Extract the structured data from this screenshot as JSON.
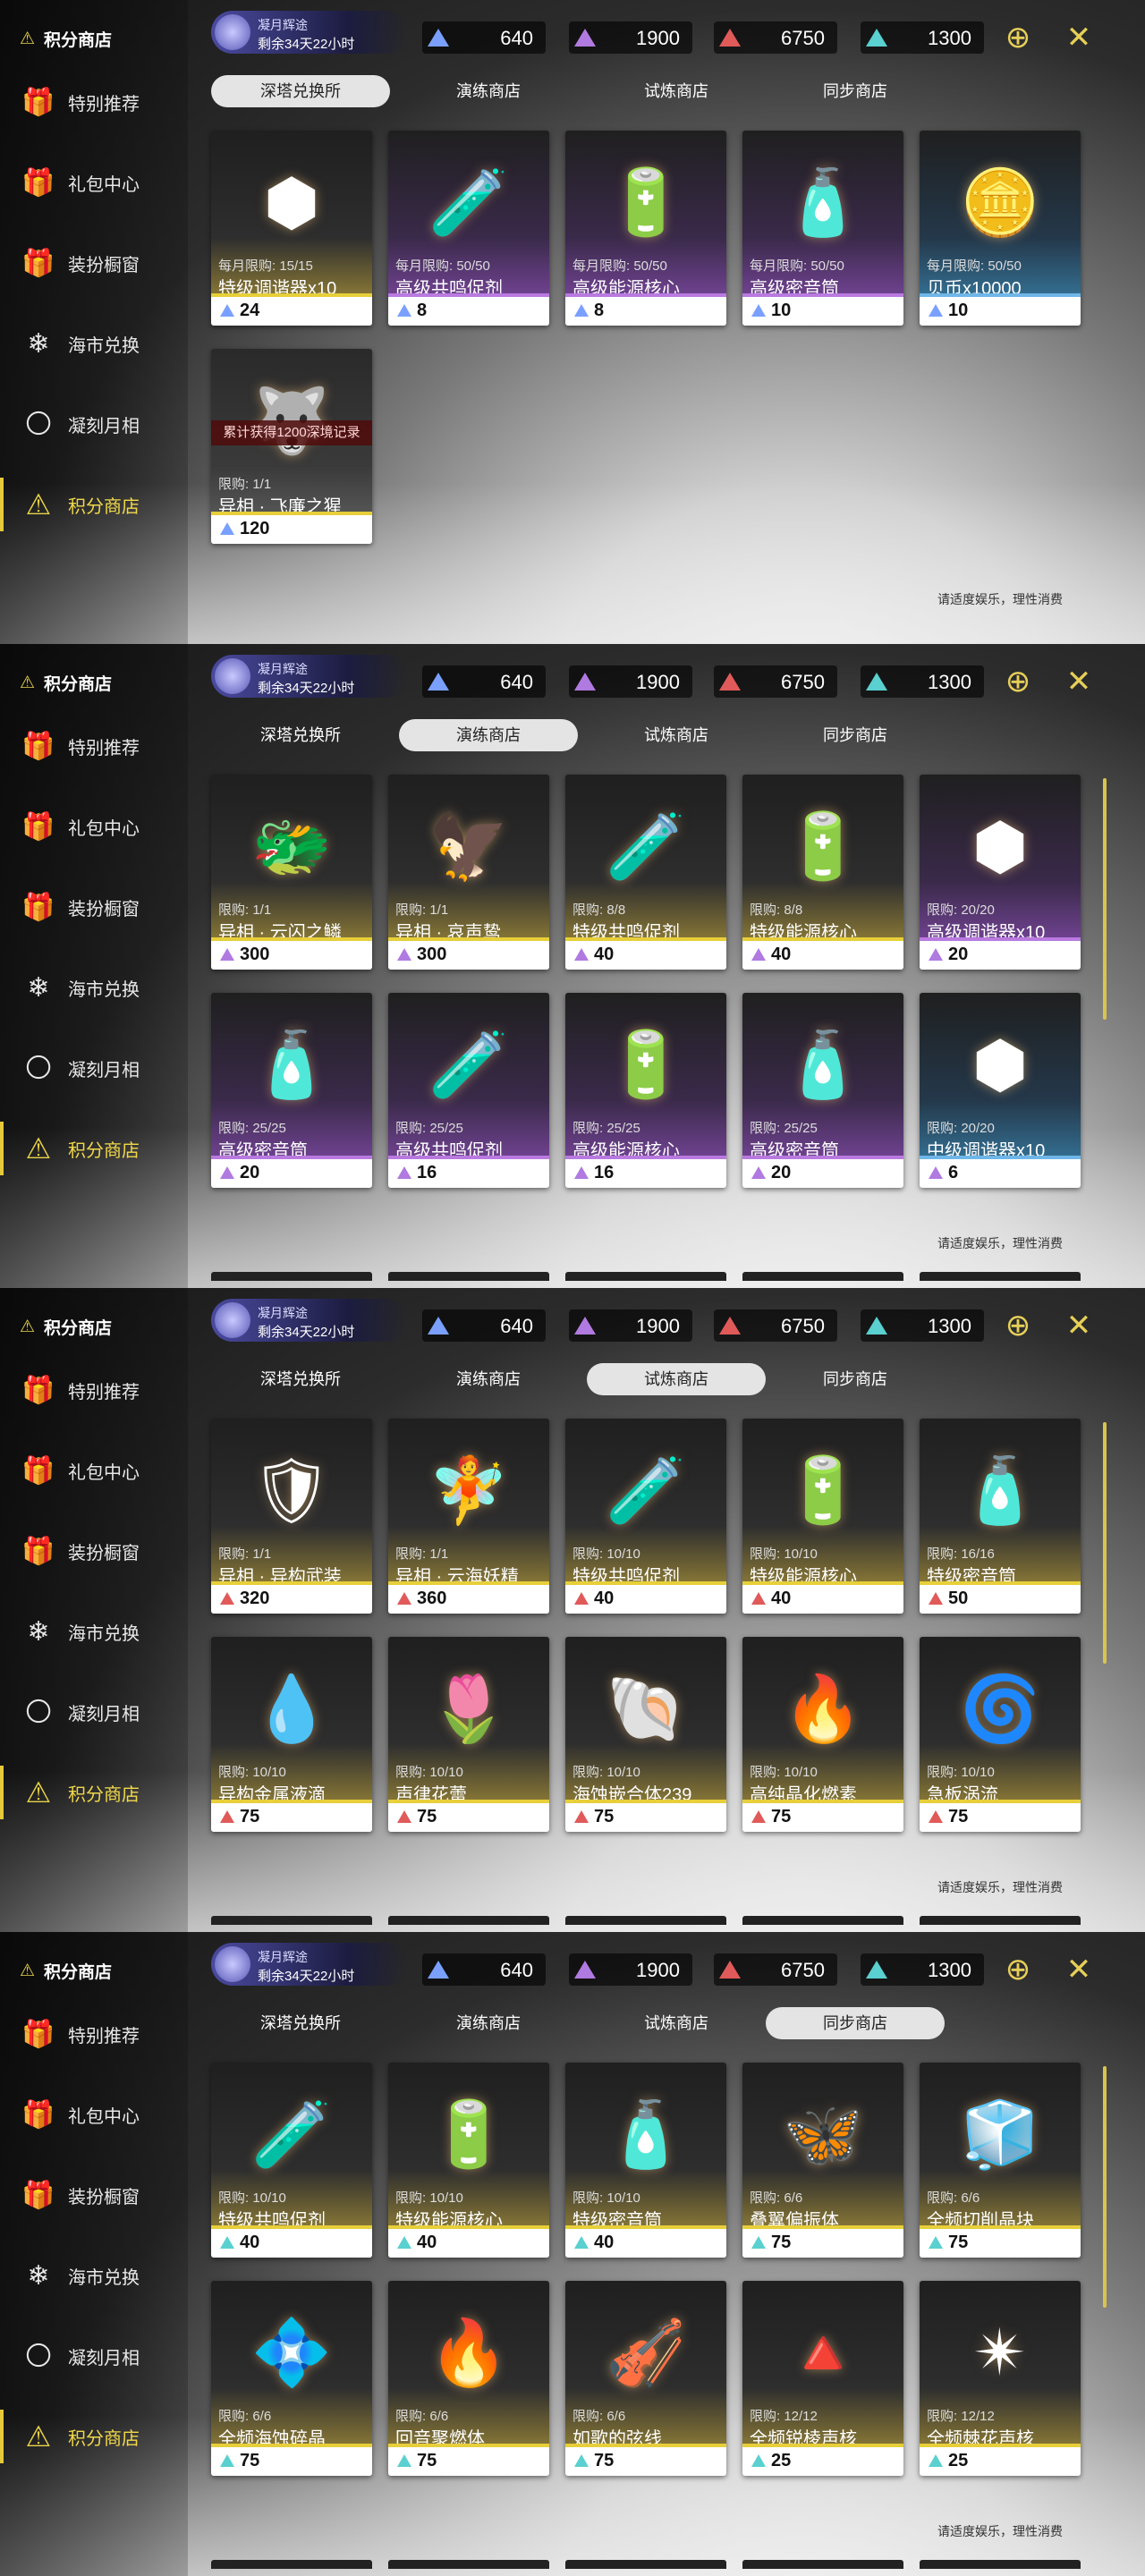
{
  "common": {
    "sidebar_title": "积分商店",
    "sidebar_items": [
      {
        "label": "特别推荐",
        "icon": "gift-pin-icon"
      },
      {
        "label": "礼包中心",
        "icon": "gift-icon"
      },
      {
        "label": "装扮橱窗",
        "icon": "wardrobe-icon"
      },
      {
        "label": "海市兑换",
        "icon": "tree-icon"
      },
      {
        "label": "凝刻月相",
        "icon": "moon-icon"
      },
      {
        "label": "积分商店",
        "icon": "triangle-icon"
      }
    ],
    "event": {
      "title": "凝月辉途",
      "time": "剩余34天22小时"
    },
    "currencies": [
      {
        "value": "640",
        "color": "#7aa0ff"
      },
      {
        "value": "1900",
        "color": "#b07ae0"
      },
      {
        "value": "6750",
        "color": "#e05a5a"
      },
      {
        "value": "1300",
        "color": "#5ad0d0"
      }
    ],
    "tabs": [
      "深塔兑换所",
      "演练商店",
      "试炼商店",
      "同步商店"
    ],
    "notice": "请适度娱乐，理性消费"
  },
  "panels": [
    {
      "active_tab": 0,
      "show_stubs": false,
      "items": [
        {
          "limit": "每月限购: 15/15",
          "name": "特级调谐器x10",
          "price": "24",
          "style": "gold",
          "gem": "#7aa0ff",
          "art": "⬢"
        },
        {
          "limit": "每月限购: 50/50",
          "name": "高级共鸣促剂",
          "price": "8",
          "style": "purple",
          "gem": "#7aa0ff",
          "art": "🧪"
        },
        {
          "limit": "每月限购: 50/50",
          "name": "高级能源核心",
          "price": "8",
          "style": "purple",
          "gem": "#7aa0ff",
          "art": "🔋"
        },
        {
          "limit": "每月限购: 50/50",
          "name": "高级密音筒",
          "price": "10",
          "style": "purple",
          "gem": "#7aa0ff",
          "art": "🧴"
        },
        {
          "limit": "每月限购: 50/50",
          "name": "贝币x10000",
          "price": "10",
          "style": "blue",
          "gem": "#7aa0ff",
          "art": "🪙"
        },
        {
          "limit": "限购: 1/1",
          "name": "异相 · 飞廉之猩",
          "price": "120",
          "style": "grey",
          "gem": "#7aa0ff",
          "art": "🐺",
          "banner": "累计获得1200深境记录"
        }
      ]
    },
    {
      "active_tab": 1,
      "show_stubs": true,
      "items": [
        {
          "limit": "限购: 1/1",
          "name": "异相 · 云闪之鳞",
          "price": "300",
          "style": "gold",
          "gem": "#b07ae0",
          "art": "🐲"
        },
        {
          "limit": "限购: 1/1",
          "name": "异相 · 哀声鸷",
          "price": "300",
          "style": "gold",
          "gem": "#b07ae0",
          "art": "🦅"
        },
        {
          "limit": "限购: 8/8",
          "name": "特级共鸣促剂",
          "price": "40",
          "style": "gold",
          "gem": "#b07ae0",
          "art": "🧪"
        },
        {
          "limit": "限购: 8/8",
          "name": "特级能源核心",
          "price": "40",
          "style": "gold",
          "gem": "#b07ae0",
          "art": "🔋"
        },
        {
          "limit": "限购: 20/20",
          "name": "高级调谐器x10",
          "price": "20",
          "style": "purple",
          "gem": "#b07ae0",
          "art": "⬢"
        },
        {
          "limit": "限购: 25/25",
          "name": "高级密音筒",
          "price": "20",
          "style": "purple",
          "gem": "#b07ae0",
          "art": "🧴"
        },
        {
          "limit": "限购: 25/25",
          "name": "高级共鸣促剂",
          "price": "16",
          "style": "purple",
          "gem": "#b07ae0",
          "art": "🧪"
        },
        {
          "limit": "限购: 25/25",
          "name": "高级能源核心",
          "price": "16",
          "style": "purple",
          "gem": "#b07ae0",
          "art": "🔋"
        },
        {
          "limit": "限购: 25/25",
          "name": "高级密音筒",
          "price": "20",
          "style": "purple",
          "gem": "#b07ae0",
          "art": "🧴"
        },
        {
          "limit": "限购: 20/20",
          "name": "中级调谐器x10",
          "price": "6",
          "style": "blue",
          "gem": "#b07ae0",
          "art": "⬢"
        }
      ]
    },
    {
      "active_tab": 2,
      "show_stubs": true,
      "items": [
        {
          "limit": "限购: 1/1",
          "name": "异相 · 异构武装",
          "price": "320",
          "style": "gold",
          "gem": "#e05a5a",
          "art": "🛡"
        },
        {
          "limit": "限购: 1/1",
          "name": "异相 · 云海妖精",
          "price": "360",
          "style": "gold",
          "gem": "#e05a5a",
          "art": "🧚"
        },
        {
          "limit": "限购: 10/10",
          "name": "特级共鸣促剂",
          "price": "40",
          "style": "gold",
          "gem": "#e05a5a",
          "art": "🧪"
        },
        {
          "limit": "限购: 10/10",
          "name": "特级能源核心",
          "price": "40",
          "style": "gold",
          "gem": "#e05a5a",
          "art": "🔋"
        },
        {
          "limit": "限购: 16/16",
          "name": "特级密音筒",
          "price": "50",
          "style": "gold",
          "gem": "#e05a5a",
          "art": "🧴"
        },
        {
          "limit": "限购: 10/10",
          "name": "异构金属液滴",
          "price": "75",
          "style": "gold",
          "gem": "#e05a5a",
          "art": "💧"
        },
        {
          "limit": "限购: 10/10",
          "name": "声律花蕾",
          "price": "75",
          "style": "gold",
          "gem": "#e05a5a",
          "art": "🌷"
        },
        {
          "limit": "限购: 10/10",
          "name": "海蚀嵌合体239",
          "price": "75",
          "style": "gold",
          "gem": "#e05a5a",
          "art": "🐚"
        },
        {
          "limit": "限购: 10/10",
          "name": "高纯晶化燃素",
          "price": "75",
          "style": "gold",
          "gem": "#e05a5a",
          "art": "🔥"
        },
        {
          "limit": "限购: 10/10",
          "name": "急板涡流",
          "price": "75",
          "style": "gold",
          "gem": "#e05a5a",
          "art": "🌀"
        }
      ]
    },
    {
      "active_tab": 3,
      "show_stubs": true,
      "items": [
        {
          "limit": "限购: 10/10",
          "name": "特级共鸣促剂",
          "price": "40",
          "style": "gold",
          "gem": "#5ad0d0",
          "art": "🧪"
        },
        {
          "limit": "限购: 10/10",
          "name": "特级能源核心",
          "price": "40",
          "style": "gold",
          "gem": "#5ad0d0",
          "art": "🔋"
        },
        {
          "limit": "限购: 10/10",
          "name": "特级密音筒",
          "price": "40",
          "style": "gold",
          "gem": "#5ad0d0",
          "art": "🧴"
        },
        {
          "limit": "限购: 6/6",
          "name": "叠翼偏振体",
          "price": "75",
          "style": "gold",
          "gem": "#5ad0d0",
          "art": "🦋"
        },
        {
          "limit": "限购: 6/6",
          "name": "全频切削晶块",
          "price": "75",
          "style": "gold",
          "gem": "#5ad0d0",
          "art": "🧊"
        },
        {
          "limit": "限购: 6/6",
          "name": "全频海蚀碎晶",
          "price": "75",
          "style": "gold",
          "gem": "#5ad0d0",
          "art": "💠"
        },
        {
          "limit": "限购: 6/6",
          "name": "回音聚燃体",
          "price": "75",
          "style": "gold",
          "gem": "#5ad0d0",
          "art": "🔥"
        },
        {
          "limit": "限购: 6/6",
          "name": "如歌的弦线",
          "price": "75",
          "style": "gold",
          "gem": "#5ad0d0",
          "art": "🎻"
        },
        {
          "limit": "限购: 12/12",
          "name": "全频锐棱声核",
          "price": "25",
          "style": "gold",
          "gem": "#5ad0d0",
          "art": "🔺"
        },
        {
          "limit": "限购: 12/12",
          "name": "全频棘花声核",
          "price": "25",
          "style": "gold",
          "gem": "#5ad0d0",
          "art": "✴"
        }
      ]
    }
  ]
}
